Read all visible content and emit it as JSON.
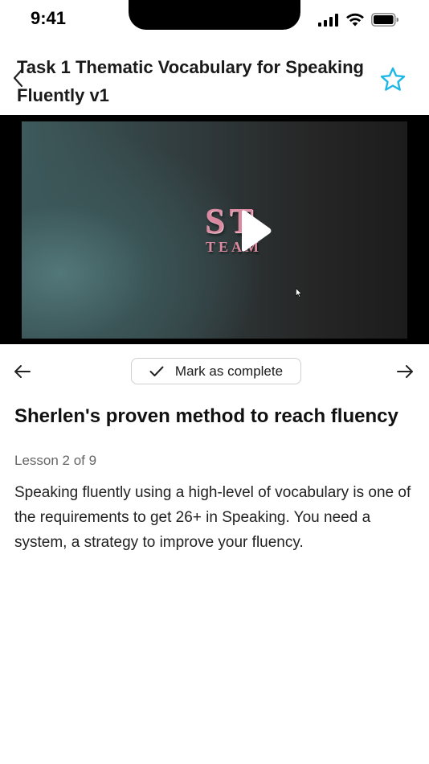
{
  "status_bar": {
    "time": "9:41",
    "icons": [
      "cellular-signal-icon",
      "wifi-icon",
      "battery-icon"
    ]
  },
  "header": {
    "title": "Task 1 Thematic Vocabulary for Speaking Fluently v1",
    "back_icon": "chevron-left-icon",
    "favorite_icon": "star-outline-icon",
    "accent_color": "#1EB8E6"
  },
  "video": {
    "logo_letters": "ST",
    "logo_subtitle": "TEAM",
    "play_icon": "play-icon"
  },
  "lesson_nav": {
    "prev_icon": "arrow-left-icon",
    "next_icon": "arrow-right-icon",
    "mark_complete_label": "Mark as complete"
  },
  "lesson": {
    "title": "Sherlen's proven method to reach fluency",
    "progress": "Lesson 2 of 9",
    "description": "Speaking fluently using a high-level of vocabulary is one of the requirements to get 26+ in Speaking. You need a system, a strategy to improve your fluency."
  }
}
